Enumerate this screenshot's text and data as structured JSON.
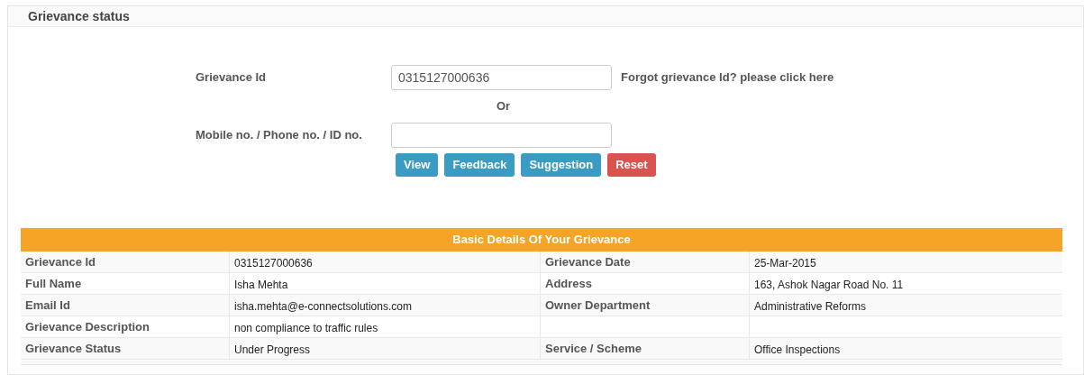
{
  "panel": {
    "title": "Grievance status"
  },
  "form": {
    "grievance_id": {
      "label": "Grievance Id",
      "value": "0315127000636"
    },
    "forgot_link": "Forgot grievance Id? please click here",
    "or": "Or",
    "mobile": {
      "label": "Mobile no. / Phone no. / ID no."
    },
    "buttons": [
      {
        "label": "View",
        "kind": "info"
      },
      {
        "label": "Feedback",
        "kind": "info"
      },
      {
        "label": "Suggestion",
        "kind": "info"
      },
      {
        "label": "Reset",
        "kind": "danger"
      }
    ]
  },
  "details": {
    "title": "Basic Details Of Your Grievance",
    "rows": [
      {
        "label": "Grievance Id",
        "value": "0315127000636",
        "label_2": "Grievance Date",
        "value_2": "25-Mar-2015"
      },
      {
        "label": "Full Name",
        "value": "Isha Mehta",
        "label_2": "Address",
        "value_2": "163, Ashok Nagar Road No. 11"
      },
      {
        "label": "Email Id",
        "value": "isha.mehta@e-connectsolutions.com",
        "label_2": "Owner Department",
        "value_2": "Administrative Reforms"
      },
      {
        "label": "Grievance Description",
        "value": "non compliance to traffic rules"
      },
      {
        "label": "Grievance Status",
        "value": "Under Progress",
        "label_2": "Service / Scheme",
        "value_2": "Office Inspections"
      }
    ]
  }
}
